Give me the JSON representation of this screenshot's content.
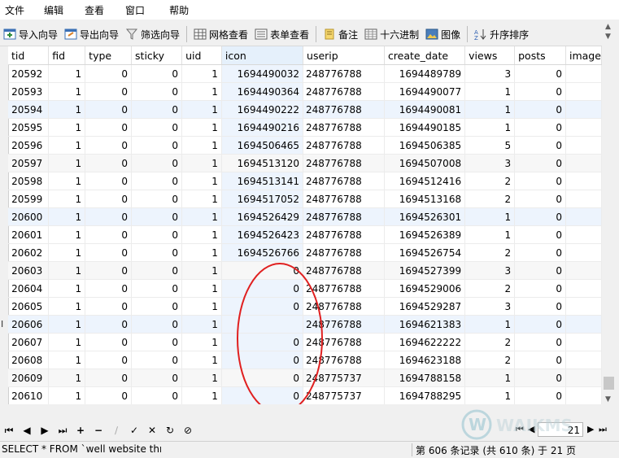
{
  "menu": [
    "文件",
    "编辑",
    "查看",
    "窗口",
    "帮助"
  ],
  "toolbar": {
    "import": "导入向导",
    "export": "导出向导",
    "filter": "筛选向导",
    "grid_view": "网格查看",
    "form_view": "表单查看",
    "memo": "备注",
    "hex": "十六进制",
    "image": "图像",
    "sort_asc": "升序排序"
  },
  "columns": [
    "tid",
    "fid",
    "type",
    "sticky",
    "uid",
    "icon",
    "userip",
    "create_date",
    "views",
    "posts",
    "image"
  ],
  "rows": [
    [
      "20592",
      "1",
      "0",
      "0",
      "1",
      "1694490032",
      "248776788",
      "1694489789",
      "3",
      "0"
    ],
    [
      "20593",
      "1",
      "0",
      "0",
      "1",
      "1694490364",
      "248776788",
      "1694490077",
      "1",
      "0"
    ],
    [
      "20594",
      "1",
      "0",
      "0",
      "1",
      "1694490222",
      "248776788",
      "1694490081",
      "1",
      "0"
    ],
    [
      "20595",
      "1",
      "0",
      "0",
      "1",
      "1694490216",
      "248776788",
      "1694490185",
      "1",
      "0"
    ],
    [
      "20596",
      "1",
      "0",
      "0",
      "1",
      "1694506465",
      "248776788",
      "1694506385",
      "5",
      "0"
    ],
    [
      "20597",
      "1",
      "0",
      "0",
      "1",
      "1694513120",
      "248776788",
      "1694507008",
      "3",
      "0"
    ],
    [
      "20598",
      "1",
      "0",
      "0",
      "1",
      "1694513141",
      "248776788",
      "1694512416",
      "2",
      "0"
    ],
    [
      "20599",
      "1",
      "0",
      "0",
      "1",
      "1694517052",
      "248776788",
      "1694513168",
      "2",
      "0"
    ],
    [
      "20600",
      "1",
      "0",
      "0",
      "1",
      "1694526429",
      "248776788",
      "1694526301",
      "1",
      "0"
    ],
    [
      "20601",
      "1",
      "0",
      "0",
      "1",
      "1694526423",
      "248776788",
      "1694526389",
      "1",
      "0"
    ],
    [
      "20602",
      "1",
      "0",
      "0",
      "1",
      "1694526766",
      "248776788",
      "1694526754",
      "2",
      "0"
    ],
    [
      "20603",
      "1",
      "0",
      "0",
      "1",
      "0",
      "248776788",
      "1694527399",
      "3",
      "0"
    ],
    [
      "20604",
      "1",
      "0",
      "0",
      "1",
      "0",
      "248776788",
      "1694529006",
      "2",
      "0"
    ],
    [
      "20605",
      "1",
      "0",
      "0",
      "1",
      "0",
      "248776788",
      "1694529287",
      "3",
      "0"
    ],
    [
      "20606",
      "1",
      "0",
      "0",
      "1",
      "",
      "248776788",
      "1694621383",
      "1",
      "0"
    ],
    [
      "20607",
      "1",
      "0",
      "0",
      "1",
      "0",
      "248776788",
      "1694622222",
      "2",
      "0"
    ],
    [
      "20608",
      "1",
      "0",
      "0",
      "1",
      "0",
      "248776788",
      "1694623188",
      "2",
      "0"
    ],
    [
      "20609",
      "1",
      "0",
      "0",
      "1",
      "0",
      "248775737",
      "1694788158",
      "1",
      "0"
    ],
    [
      "20610",
      "1",
      "0",
      "0",
      "1",
      "0",
      "248775737",
      "1694788295",
      "1",
      "0"
    ]
  ],
  "navigation": {
    "page": "21"
  },
  "status": {
    "sql": "SELECT * FROM `well website thre",
    "record_info": "第 606 条记录 (共 610 条) 于 21 页"
  },
  "watermark_text": "WAIKMS"
}
